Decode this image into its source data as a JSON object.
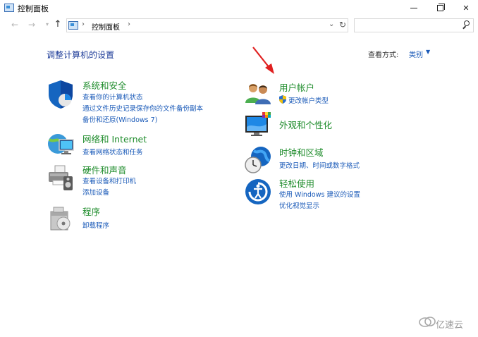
{
  "window": {
    "title": "控制面板"
  },
  "address_bar": {
    "breadcrumb": "控制面板",
    "separator": "›",
    "search_placeholder": ""
  },
  "header": {
    "heading": "调整计算机的设置",
    "view_by_label": "查看方式:",
    "view_by_value": "类别"
  },
  "categories": [
    {
      "title": "系统和安全",
      "icon": "shield-icon",
      "links": [
        "查看你的计算机状态",
        "通过文件历史记录保存你的文件备份副本",
        "备份和还原(Windows 7)"
      ]
    },
    {
      "title": "网络和 Internet",
      "icon": "network-globe-icon",
      "links": [
        "查看网络状态和任务"
      ]
    },
    {
      "title": "硬件和声音",
      "icon": "printer-icon",
      "links": [
        "查看设备和打印机",
        "添加设备"
      ]
    },
    {
      "title": "程序",
      "icon": "programs-icon",
      "links": [
        "卸载程序"
      ]
    },
    {
      "title": "用户帐户",
      "icon": "users-icon",
      "links": [
        "更改帐户类型"
      ]
    },
    {
      "title": "外观和个性化",
      "icon": "monitor-palette-icon",
      "links": []
    },
    {
      "title": "时钟和区域",
      "icon": "clock-globe-icon",
      "links": [
        "更改日期、时间或数字格式"
      ]
    },
    {
      "title": "轻松使用",
      "icon": "ease-of-access-icon",
      "links": [
        "使用 Windows 建议的设置",
        "优化视觉显示"
      ]
    }
  ],
  "watermark": {
    "text": "亿速云"
  },
  "colors": {
    "category_title": "#1e8c2b",
    "link": "#1a5ab8",
    "heading": "#1f3d99",
    "annotation_arrow": "#e02020"
  }
}
